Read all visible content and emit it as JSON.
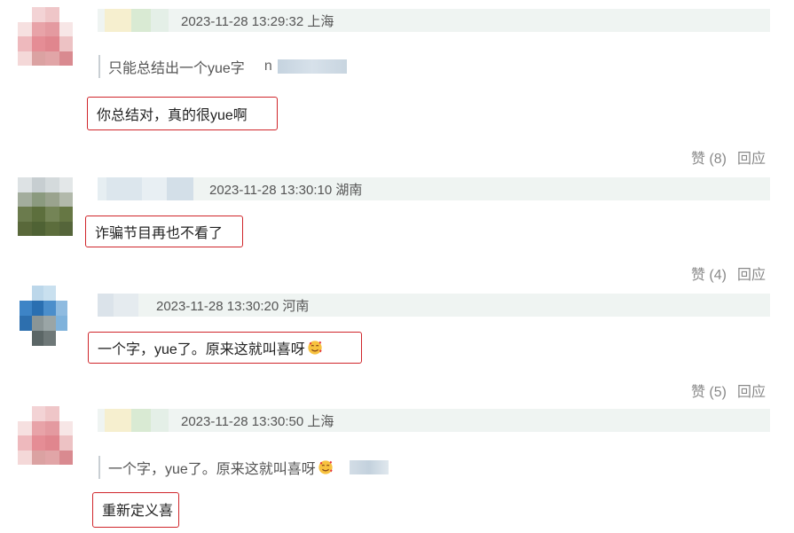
{
  "comments": [
    {
      "timestamp": "2023-11-28 13:29:32",
      "location": "上海",
      "quote": {
        "text": "只能总结出一个yue字",
        "author": "n"
      },
      "reply": "你总结对，真的很yue啊",
      "likes_label": "赞",
      "likes_count": "(8)",
      "reply_label": "回应"
    },
    {
      "timestamp": "2023-11-28 13:30:10",
      "location": "湖南",
      "reply": "诈骗节目再也不看了",
      "likes_label": "赞",
      "likes_count": "(4)",
      "reply_label": "回应"
    },
    {
      "timestamp": "2023-11-28 13:30:20",
      "location": "河南",
      "reply": "一个字，yue了。原来这就叫喜呀",
      "likes_label": "赞",
      "likes_count": "(5)",
      "reply_label": "回应"
    },
    {
      "timestamp": "2023-11-28 13:30:50",
      "location": "上海",
      "quote": {
        "text": "一个字，yue了。原来这就叫喜呀"
      },
      "reply": "重新定义喜"
    }
  ],
  "icons": {
    "emoji": "smiling-face-with-hearts-icon"
  },
  "colors": {
    "highlight_border": "#d0262b",
    "meta_bar": "#eff4f2",
    "muted_text": "#888888"
  }
}
